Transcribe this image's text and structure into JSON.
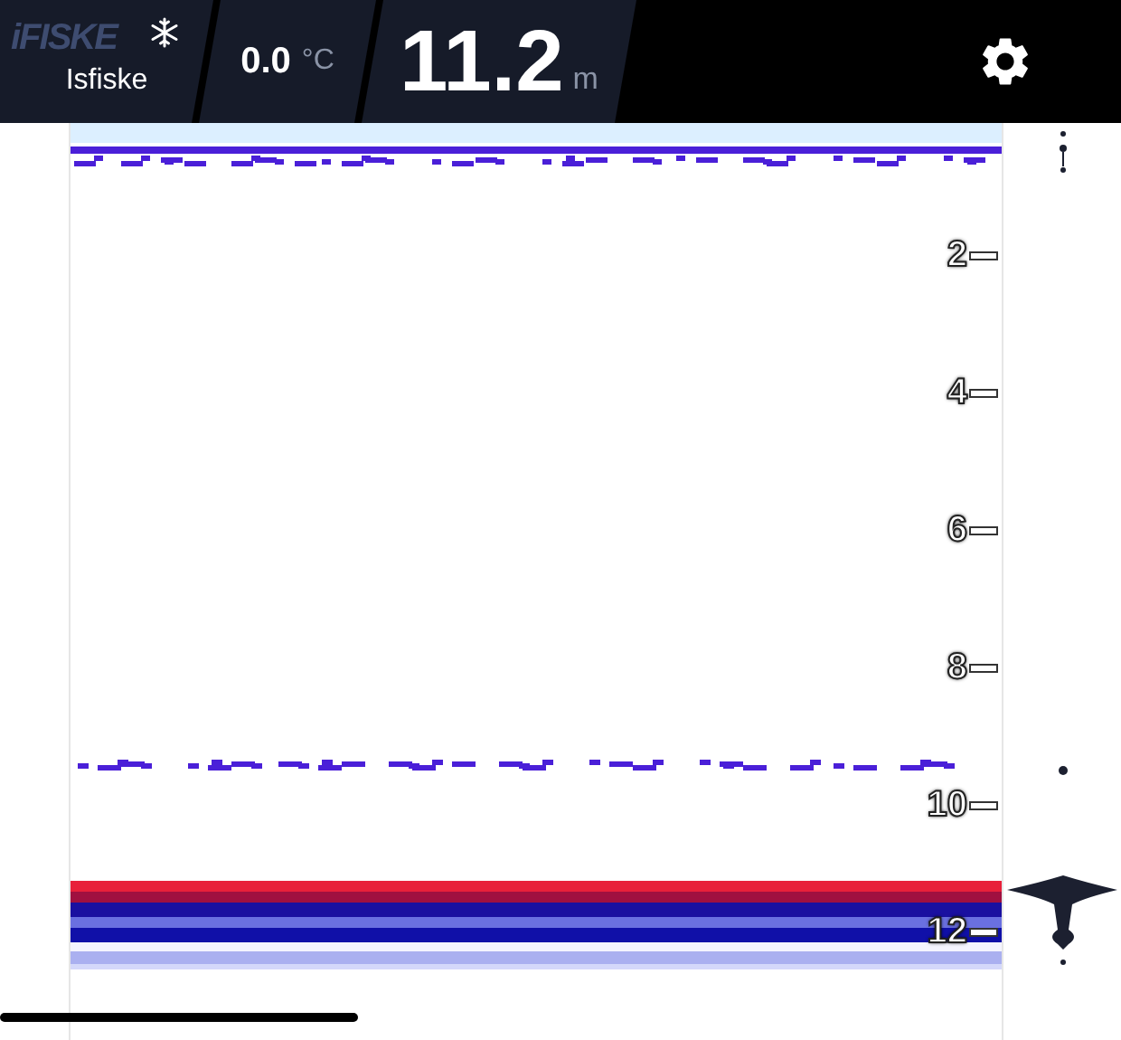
{
  "header": {
    "logo": "iFISKE",
    "mode": "Isfiske",
    "temperature": {
      "value": "0.0",
      "unit": "°C"
    },
    "depth": {
      "value": "11.2",
      "unit": "m"
    }
  },
  "depth_scale": [
    "2",
    "4",
    "6",
    "8",
    "10",
    "12"
  ]
}
